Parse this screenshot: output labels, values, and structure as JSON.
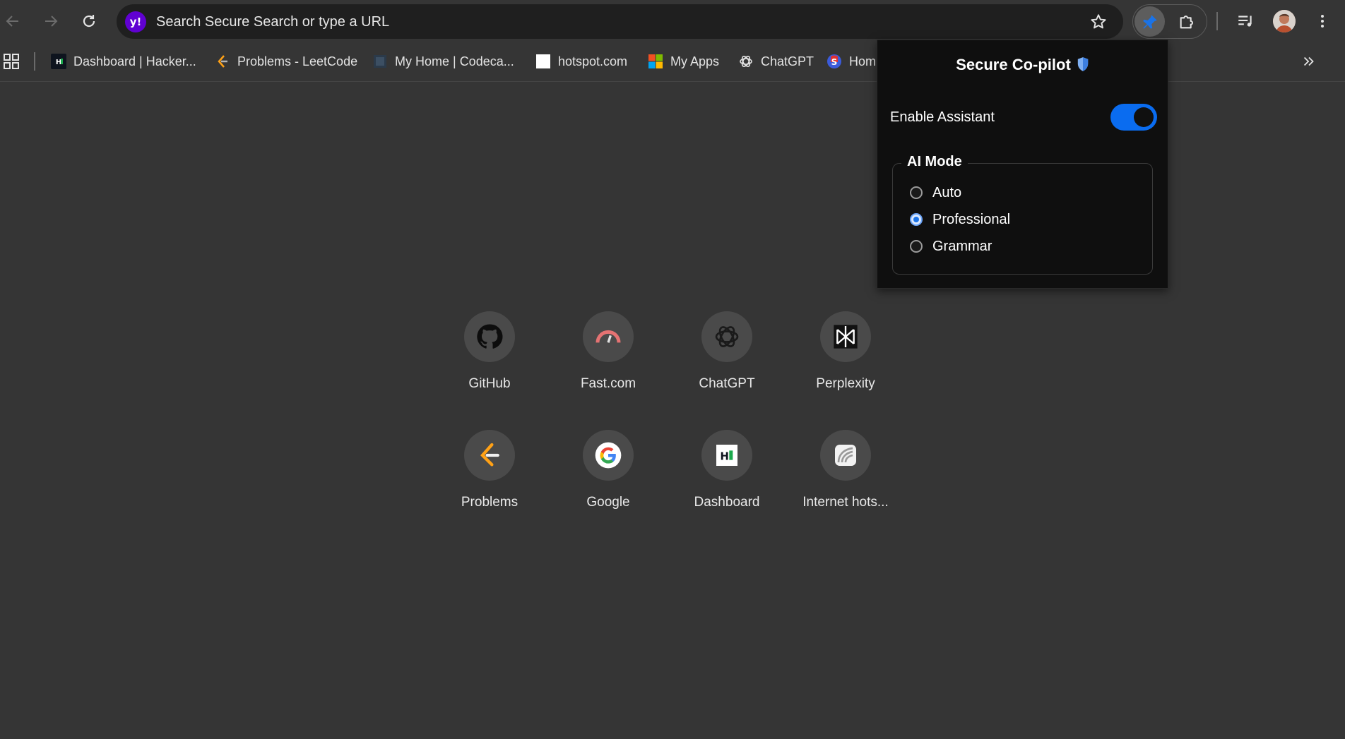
{
  "omnibox": {
    "placeholder": "Search Secure Search or type a URL",
    "engine_logo": "y!"
  },
  "bookmarks": [
    {
      "label": "Dashboard | Hacker...",
      "icon": "hackerrank-icon"
    },
    {
      "label": "Problems - LeetCode",
      "icon": "leetcode-icon"
    },
    {
      "label": "My Home | Codeca...",
      "icon": "codecademy-icon"
    },
    {
      "label": "hotspot.com",
      "icon": "blank-page-icon"
    },
    {
      "label": "My Apps",
      "icon": "microsoft-icon"
    },
    {
      "label": "ChatGPT",
      "icon": "openai-icon"
    },
    {
      "label": "Hom",
      "icon": "home-s-icon"
    }
  ],
  "shortcuts": [
    {
      "label": "GitHub",
      "icon": "github-icon"
    },
    {
      "label": "Fast.com",
      "icon": "speedometer-icon"
    },
    {
      "label": "ChatGPT",
      "icon": "openai-icon"
    },
    {
      "label": "Perplexity",
      "icon": "perplexity-icon"
    },
    {
      "label": "Problems",
      "icon": "leetcode-icon"
    },
    {
      "label": "Google",
      "icon": "google-icon"
    },
    {
      "label": "Dashboard",
      "icon": "hackerrank-icon"
    },
    {
      "label": "Internet hots...",
      "icon": "hotspot-icon"
    }
  ],
  "popup": {
    "title": "Secure Co-pilot",
    "enable_label": "Enable Assistant",
    "enabled": true,
    "mode_legend": "AI Mode",
    "modes": [
      "Auto",
      "Professional",
      "Grammar"
    ],
    "selected_mode": "Professional"
  },
  "colors": {
    "background": "#353535",
    "omnibox": "#1f1f1f",
    "popup_bg": "#0f0f0f",
    "toggle_on": "#0a6cf0",
    "search_engine": "#6001d2"
  }
}
